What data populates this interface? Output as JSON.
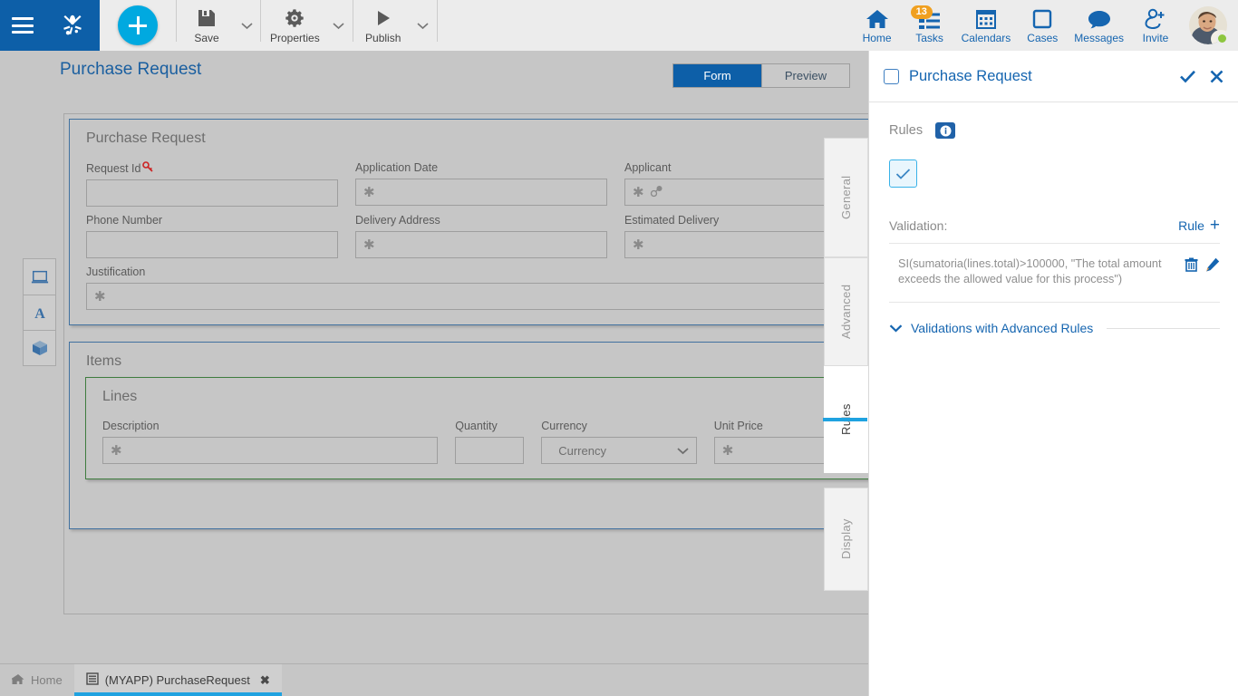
{
  "topbar": {
    "menu_icon": "hamburger-icon",
    "logo_icon": "bizagi-frog-logo",
    "add_label": "+",
    "tools": [
      {
        "label": "Save",
        "icon": "save-floppy-icon"
      },
      {
        "label": "Properties",
        "icon": "gear-icon"
      },
      {
        "label": "Publish",
        "icon": "play-triangle-icon"
      }
    ],
    "right_items": [
      {
        "label": "Home",
        "icon": "home-icon",
        "badge": ""
      },
      {
        "label": "Tasks",
        "icon": "tasks-list-icon",
        "badge": "13"
      },
      {
        "label": "Calendars",
        "icon": "calendar-icon",
        "badge": ""
      },
      {
        "label": "Cases",
        "icon": "cases-square-icon",
        "badge": ""
      },
      {
        "label": "Messages",
        "icon": "message-bubble-icon",
        "badge": ""
      },
      {
        "label": "Invite",
        "icon": "invite-person-plus-icon",
        "badge": ""
      }
    ],
    "avatar": {
      "icon": "user-avatar",
      "presence": "online"
    }
  },
  "workspace": {
    "title": "Purchase Request",
    "status_icon": "green-status-dot",
    "view_tabs": [
      {
        "label": "Form",
        "active": true
      },
      {
        "label": "Preview",
        "active": false
      }
    ],
    "mini_tools": [
      {
        "icon": "device-laptop-icon"
      },
      {
        "icon": "text-font-a-icon"
      },
      {
        "icon": "3d-cube-icon"
      }
    ],
    "form": {
      "panel_title": "Purchase Request",
      "rows": [
        [
          {
            "label": "Request Id",
            "required": false,
            "key_icon": true,
            "value": "",
            "type": "text",
            "width": "normal"
          },
          {
            "label": "Application Date",
            "required": true,
            "key_icon": false,
            "value": "",
            "type": "text",
            "width": "normal"
          },
          {
            "label": "Applicant",
            "required": true,
            "key_icon": false,
            "person_icon": true,
            "value": "",
            "type": "text",
            "width": "normal"
          }
        ],
        [
          {
            "label": "Phone Number",
            "required": false,
            "key_icon": false,
            "value": "",
            "type": "text",
            "width": "normal"
          },
          {
            "label": "Delivery Address",
            "required": true,
            "key_icon": false,
            "value": "",
            "type": "text",
            "width": "normal"
          },
          {
            "label": "Estimated Delivery",
            "required": true,
            "key_icon": false,
            "value": "",
            "type": "text",
            "width": "normal"
          }
        ],
        [
          {
            "label": "Justification",
            "required": true,
            "key_icon": false,
            "value": "",
            "type": "text",
            "width": "wide"
          }
        ]
      ],
      "items_panel_title": "Items",
      "lines_panel_title": "Lines",
      "lines_fields": [
        {
          "label": "Description",
          "required": true,
          "value": "",
          "type": "text"
        },
        {
          "label": "Quantity",
          "required": false,
          "value": "",
          "type": "text"
        },
        {
          "label": "Currency",
          "required": false,
          "value": "Currency",
          "type": "select"
        },
        {
          "label": "Unit Price",
          "required": true,
          "value": "",
          "type": "text"
        }
      ]
    },
    "vertical_tabs": [
      {
        "label": "General",
        "active": false
      },
      {
        "label": "Advanced",
        "active": false
      },
      {
        "label": "Rules",
        "active": true
      },
      {
        "label": "Display",
        "active": false
      }
    ]
  },
  "right_panel": {
    "title": "Purchase Request",
    "confirm_icon": "check-icon",
    "close_icon": "close-x-icon",
    "rules_label": "Rules",
    "info_icon": "info-circle-icon",
    "checkbox_checked": true,
    "validation_label": "Validation:",
    "rule_add_label": "Rule",
    "rule_add_icon": "plus-icon",
    "rules": [
      {
        "expression": "SI(sumatoria(lines.total)>100000, \"The total amount exceeds the allowed value for this process\")",
        "delete_icon": "trash-icon",
        "edit_icon": "pencil-icon"
      }
    ],
    "advanced_section_label": "Validations with Advanced Rules",
    "advanced_caret_icon": "chevron-down-icon"
  },
  "bottombar": {
    "tabs": [
      {
        "label": "Home",
        "icon": "home-small-icon",
        "active": false,
        "closable": false
      },
      {
        "label": "(MYAPP) PurchaseRequest",
        "icon": "form-doc-icon",
        "active": true,
        "closable": true,
        "close_label": "✖"
      }
    ]
  },
  "colors": {
    "brand_blue": "#0d5fa8",
    "accent_cyan": "#00a9e0",
    "link_blue": "#1565b0",
    "badge_orange": "#f0a020",
    "status_green": "#7fa830",
    "panel_green": "#3f7d3f",
    "workspace_gray": "#c6c6c6"
  }
}
